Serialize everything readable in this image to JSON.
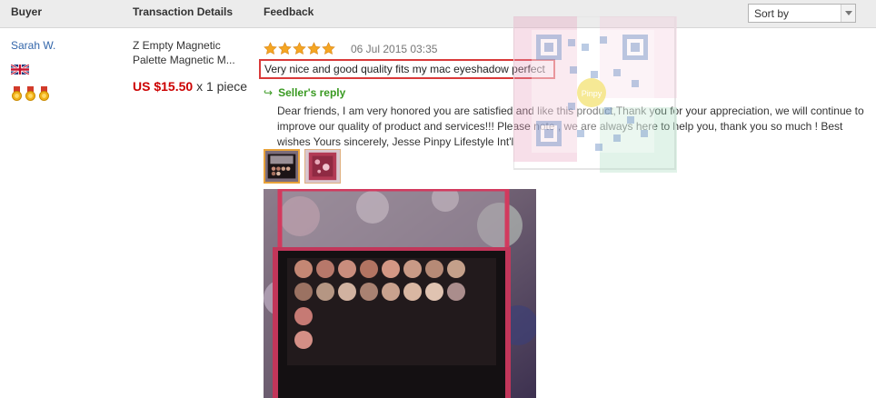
{
  "header": {
    "buyer": "Buyer",
    "transaction": "Transaction Details",
    "feedback": "Feedback",
    "sort": {
      "selected": "Sort by"
    }
  },
  "buyer": {
    "name": "Sarah W.",
    "flag_icon": "uk-flag-icon",
    "medals": [
      "medal-icon",
      "medal-icon",
      "medal-icon"
    ]
  },
  "transaction": {
    "title": "Z Empty Magnetic Palette Magnetic M...",
    "price": "US $15.50",
    "qty": "x 1 piece"
  },
  "feedback": {
    "rating": 5,
    "date": "06 Jul 2015 03:35",
    "text": "Very nice and good quality fits my mac eyeshadow perfect"
  },
  "reply": {
    "label": "Seller's reply",
    "text": "Dear friends, I am very honored you are satisfied and like this product,Thank you for your appreciation, we will continue to improve our quality of product and services!!! Please note , we are always here to help you, thank you so much ! Best wishes Yours sincerely, Jesse Pinpy Lifestyle Int'l"
  },
  "watermark": {
    "text": "Pinpy"
  },
  "colors": {
    "price": "#cc0000",
    "reply": "#3a9a22",
    "highlight": "#d93a3a",
    "link": "#3366aa"
  }
}
